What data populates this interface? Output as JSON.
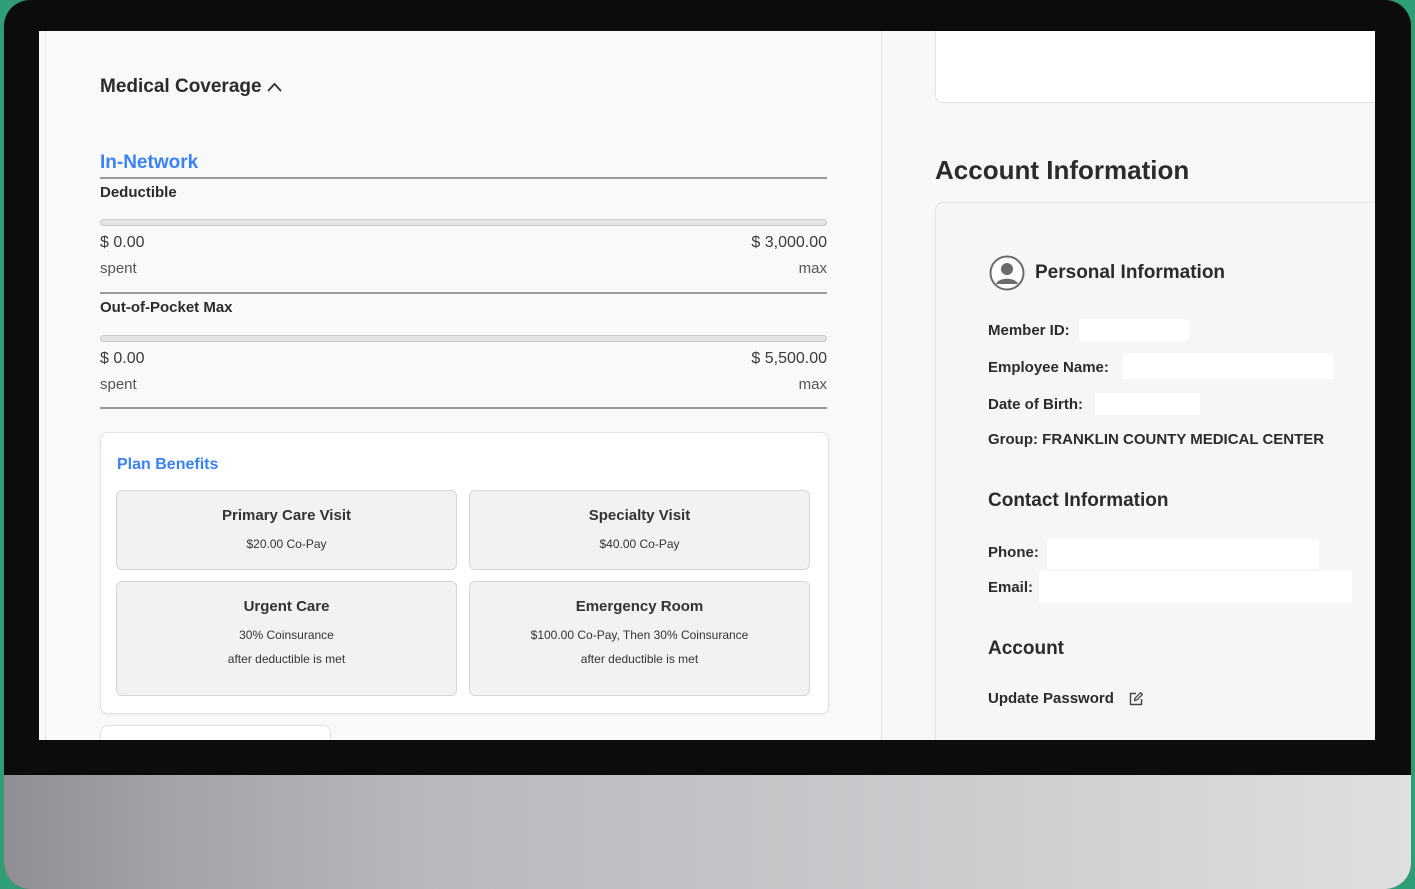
{
  "medical_coverage": {
    "title": "Medical Coverage",
    "network": "In-Network",
    "deductible": {
      "label": "Deductible",
      "spent_value": "$ 0.00",
      "spent_label": "spent",
      "max_value": "$ 3,000.00",
      "max_label": "max",
      "progress": 0
    },
    "out_of_pocket": {
      "label": "Out-of-Pocket Max",
      "spent_value": "$ 0.00",
      "spent_label": "spent",
      "max_value": "$ 5,500.00",
      "max_label": "max",
      "progress": 0
    }
  },
  "plan_benefits": {
    "title": "Plan Benefits",
    "cards": [
      {
        "title": "Primary Care Visit",
        "line1": "$20.00 Co-Pay",
        "line2": ""
      },
      {
        "title": "Specialty Visit",
        "line1": "$40.00 Co-Pay",
        "line2": ""
      },
      {
        "title": "Urgent Care",
        "line1": "30% Coinsurance",
        "line2": "after deductible is met"
      },
      {
        "title": "Emergency Room",
        "line1": "$100.00 Co-Pay, Then 30% Coinsurance",
        "line2": "after deductible is met"
      }
    ]
  },
  "account": {
    "heading": "Account Information",
    "personal": {
      "title": "Personal Information",
      "member_id_label": "Member ID:",
      "employee_name_label": "Employee Name:",
      "dob_label": "Date of Birth:",
      "group_label": "Group:",
      "group_value": "FRANKLIN COUNTY MEDICAL CENTER"
    },
    "contact": {
      "title": "Contact Information",
      "phone_label": "Phone:",
      "email_label": "Email:"
    },
    "account_section": {
      "title": "Account",
      "update_password": "Update Password"
    }
  },
  "colors": {
    "accent": "#3b82f6",
    "background": "#2f9e77",
    "bezel": "#0c0c0c"
  },
  "icons": [
    "chevron-up-icon",
    "user-avatar-icon",
    "edit-icon"
  ]
}
